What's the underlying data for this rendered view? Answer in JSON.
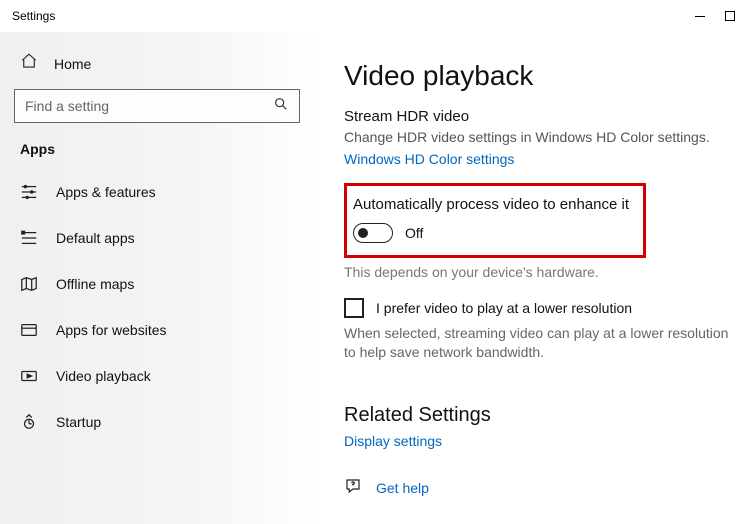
{
  "titlebar": {
    "title": "Settings"
  },
  "sidebar": {
    "home_label": "Home",
    "search_placeholder": "Find a setting",
    "section_title": "Apps",
    "items": [
      {
        "label": "Apps & features"
      },
      {
        "label": "Default apps"
      },
      {
        "label": "Offline maps"
      },
      {
        "label": "Apps for websites"
      },
      {
        "label": "Video playback"
      },
      {
        "label": "Startup"
      }
    ]
  },
  "main": {
    "page_title": "Video playback",
    "hdr": {
      "heading": "Stream HDR video",
      "desc": "Change HDR video settings in Windows HD Color settings.",
      "link": "Windows HD Color settings"
    },
    "auto_process": {
      "heading": "Automatically process video to enhance it",
      "toggle_state": "Off",
      "note": "This depends on your device's hardware."
    },
    "lower_res": {
      "label": "I prefer video to play at a lower resolution",
      "desc": "When selected, streaming video can play at a lower resolution to help save network bandwidth."
    },
    "related": {
      "heading": "Related Settings",
      "link": "Display settings"
    },
    "help_link": "Get help"
  }
}
